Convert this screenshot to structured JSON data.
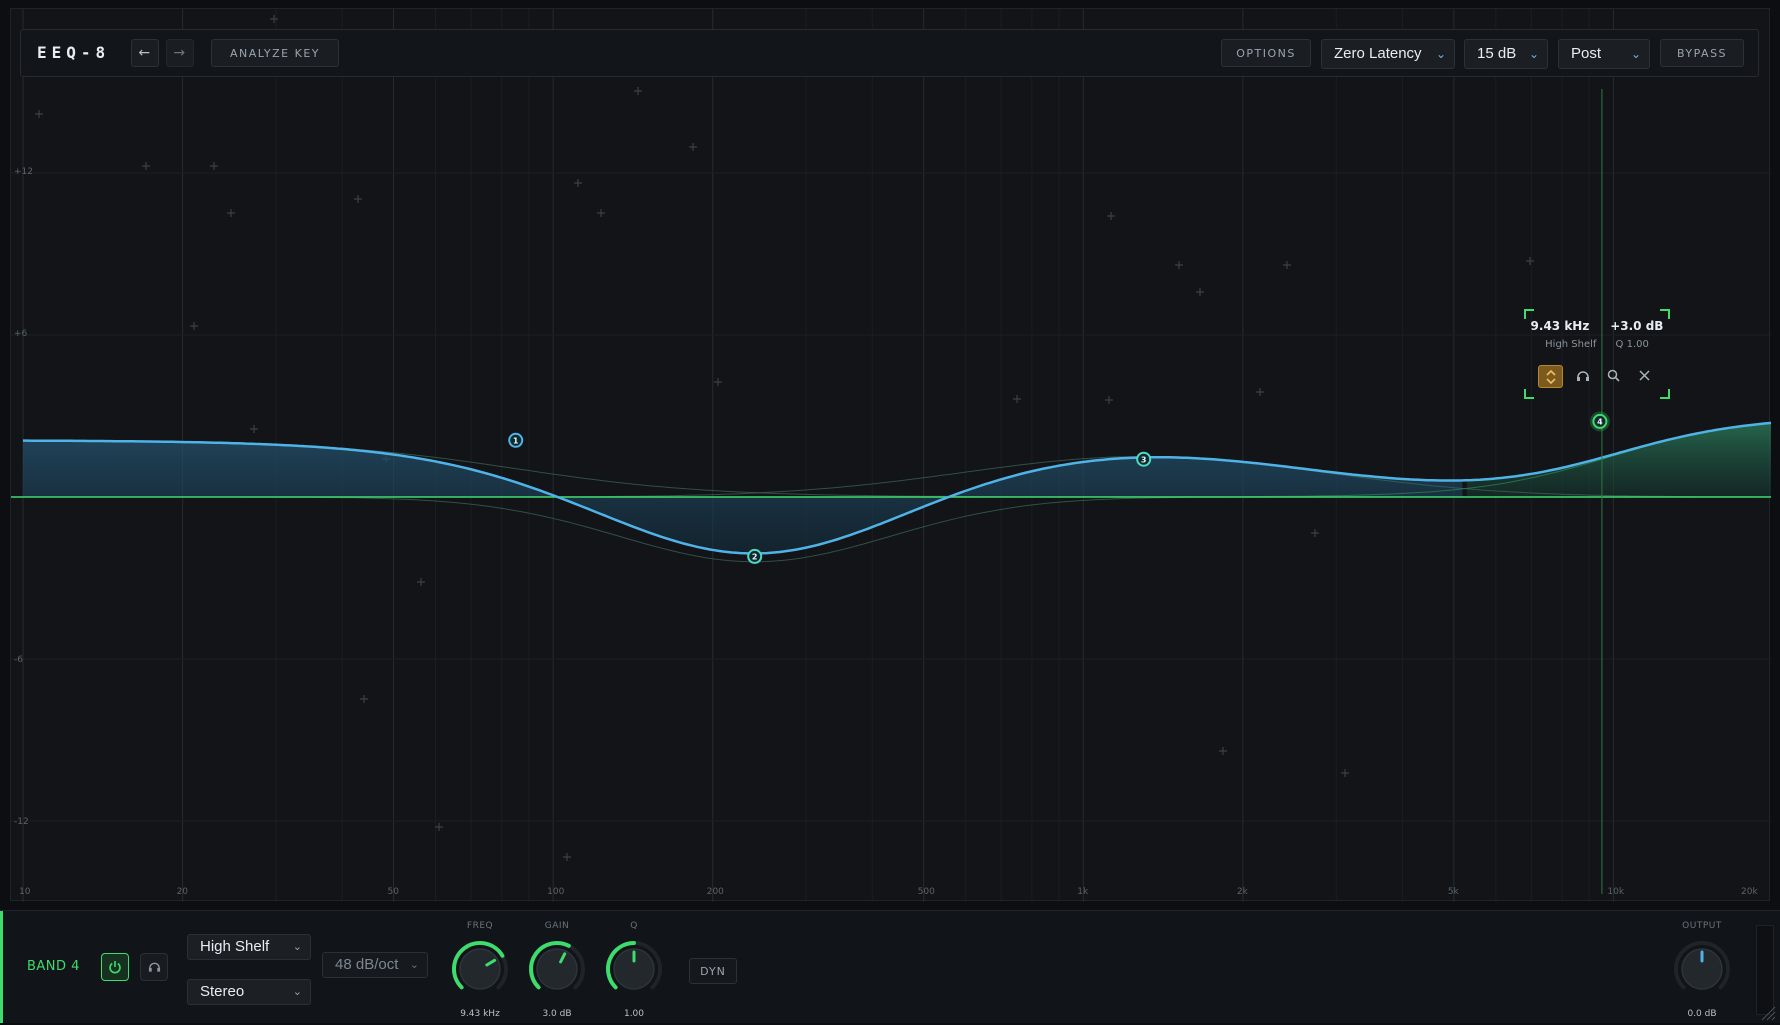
{
  "app": {
    "title": "EEQ-8",
    "undo_icon": "arrow-left-icon",
    "redo_icon": "arrow-right-icon",
    "analyze_label": "ANALYZE KEY",
    "options_label": "OPTIONS",
    "latency_value": "Zero Latency",
    "range_value": "15 dB",
    "mode_value": "Post",
    "bypass_label": "BYPASS"
  },
  "colors": {
    "curve": "#4fb3e8",
    "accent_green": "#3ddc6c",
    "fill_blue": "#1c3a4e",
    "fill_green": "#1d4a3a"
  },
  "graph": {
    "y_ticks": [
      "+12",
      "+6",
      "-6",
      "-12"
    ],
    "x_ticks": [
      "10",
      "20",
      "50",
      "100",
      "200",
      "500",
      "1k",
      "2k",
      "5k",
      "10k",
      "20k"
    ],
    "db_range": [
      -15,
      15
    ],
    "freq_range": [
      10,
      20000
    ]
  },
  "bands": [
    {
      "id": "1",
      "type": "Low Shelf",
      "freq_hz": 85,
      "gain_db": 2.1
    },
    {
      "id": "2",
      "type": "Bell",
      "freq_hz": 240,
      "gain_db": -2.4
    },
    {
      "id": "3",
      "type": "Bell",
      "freq_hz": 1300,
      "gain_db": 1.5
    },
    {
      "id": "4",
      "type": "High Shelf",
      "freq_hz": 9430,
      "gain_db": 3.0,
      "selected": true
    }
  ],
  "tooltip": {
    "freq": "9.43 kHz",
    "gain": "+3.0 dB",
    "type": "High Shelf",
    "q": "Q 1.00",
    "icons": [
      "shape-toggle-icon",
      "headphones-icon",
      "search-icon",
      "close-icon"
    ]
  },
  "bottom": {
    "band_label": "BAND 4",
    "power_icon": "power-icon",
    "solo_icon": "headphones-icon",
    "filter_type": "High Shelf",
    "channel": "Stereo",
    "slope": "48 dB/oct",
    "dyn_label": "DYN",
    "knobs": {
      "freq": {
        "title": "FREQ",
        "value": "9.43 kHz",
        "level": 0.72
      },
      "gain": {
        "title": "GAIN",
        "value": "3.0 dB",
        "level": 0.6
      },
      "q": {
        "title": "Q",
        "value": "1.00",
        "level": 0.5
      },
      "output": {
        "title": "OUTPUT",
        "value": "0.0 dB",
        "level": 0.5
      }
    }
  }
}
